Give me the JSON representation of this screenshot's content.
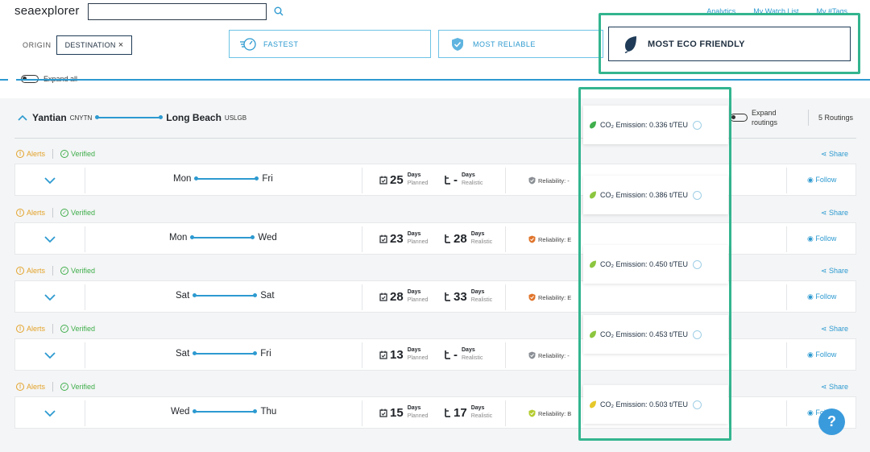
{
  "app": {
    "logo": "seaexplorer"
  },
  "search": {
    "value": "",
    "placeholder": ""
  },
  "top_links": [
    "Analytics",
    "My Watch List",
    "My #Tags"
  ],
  "filters": {
    "origin_label": "ORIGIN",
    "destination_label": "DESTINATION",
    "destination_clear": "×"
  },
  "sort_options": {
    "fastest": "FASTEST",
    "most_reliable": "MOST RELIABLE",
    "most_eco_friendly": "MOST ECO FRIENDLY"
  },
  "expand_all_label": "Expand all",
  "route": {
    "origin_city": "Yantian",
    "origin_code": "CNYTN",
    "destination_city": "Long Beach",
    "destination_code": "USLGB",
    "expand_routings_label": "Expand routings",
    "routings_count": "5 Routings"
  },
  "labels": {
    "alerts": "Alerts",
    "verified": "Verified",
    "share": "Share",
    "follow": "Follow",
    "days": "Days",
    "planned": "Planned",
    "realistic": "Realistic"
  },
  "routings": [
    {
      "depart_day": "Mon",
      "arrive_day": "Fri",
      "planned_days": "25",
      "realistic_days": "-",
      "reliability": "Reliability: -",
      "reliability_color": "#8a8f95",
      "co2": "CO₂ Emission: 0.336 t/TEU",
      "leaf_color": "#3fae4b"
    },
    {
      "depart_day": "Mon",
      "arrive_day": "Wed",
      "planned_days": "23",
      "realistic_days": "28",
      "reliability": "Reliability: E",
      "reliability_color": "#e0742b",
      "co2": "CO₂ Emission: 0.386 t/TEU",
      "leaf_color": "#8cc63f"
    },
    {
      "depart_day": "Sat",
      "arrive_day": "Sat",
      "planned_days": "28",
      "realistic_days": "33",
      "reliability": "Reliability: E",
      "reliability_color": "#e0742b",
      "co2": "CO₂ Emission: 0.450 t/TEU",
      "leaf_color": "#8cc63f"
    },
    {
      "depart_day": "Sat",
      "arrive_day": "Fri",
      "planned_days": "13",
      "realistic_days": "-",
      "reliability": "Reliability: -",
      "reliability_color": "#8a8f95",
      "co2": "CO₂ Emission: 0.453 t/TEU",
      "leaf_color": "#8cc63f"
    },
    {
      "depart_day": "Wed",
      "arrive_day": "Thu",
      "planned_days": "15",
      "realistic_days": "17",
      "reliability": "Reliability: B",
      "reliability_color": "#b5cc2f",
      "co2": "CO₂ Emission: 0.503 t/TEU",
      "leaf_color": "#e6c82a"
    }
  ],
  "help_label": "?"
}
